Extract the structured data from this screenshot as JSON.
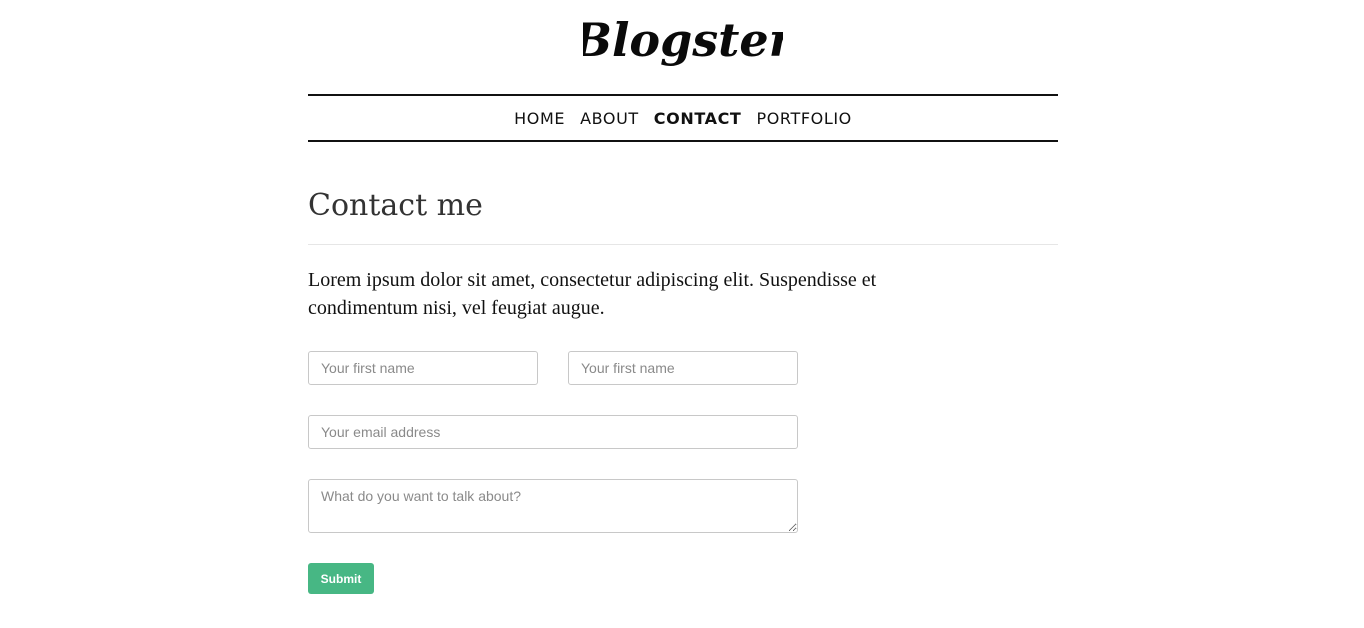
{
  "brand": {
    "logo_text": "Blogster"
  },
  "nav": {
    "items": [
      {
        "label": "HOME",
        "active": false
      },
      {
        "label": "ABOUT",
        "active": false
      },
      {
        "label": "CONTACT",
        "active": true
      },
      {
        "label": "PORTFOLIO",
        "active": false
      }
    ]
  },
  "main": {
    "title": "Contact me",
    "intro": "Lorem ipsum dolor sit amet, consectetur adipiscing elit. Suspendisse et condimentum nisi, vel feugiat augue."
  },
  "form": {
    "first_name_placeholder": "Your first name",
    "last_name_placeholder": "Your first name",
    "email_placeholder": "Your email address",
    "message_placeholder": "What do you want to talk about?",
    "submit_label": "Submit"
  },
  "colors": {
    "accent": "#47b784",
    "nav_border": "#111111",
    "text": "#222222"
  }
}
